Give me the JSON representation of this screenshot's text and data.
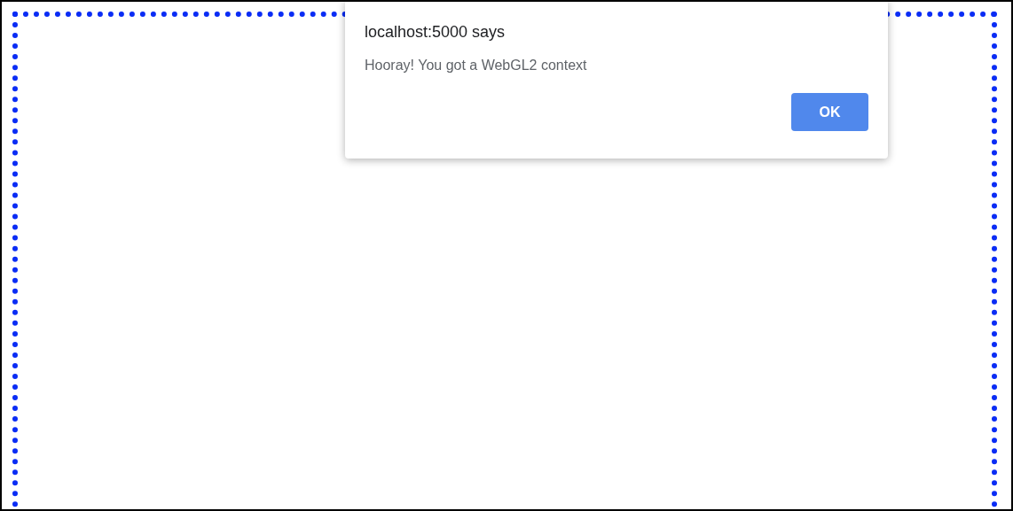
{
  "dialog": {
    "title": "localhost:5000 says",
    "message": "Hooray! You got a WebGL2 context",
    "buttons": [
      "OK"
    ]
  }
}
